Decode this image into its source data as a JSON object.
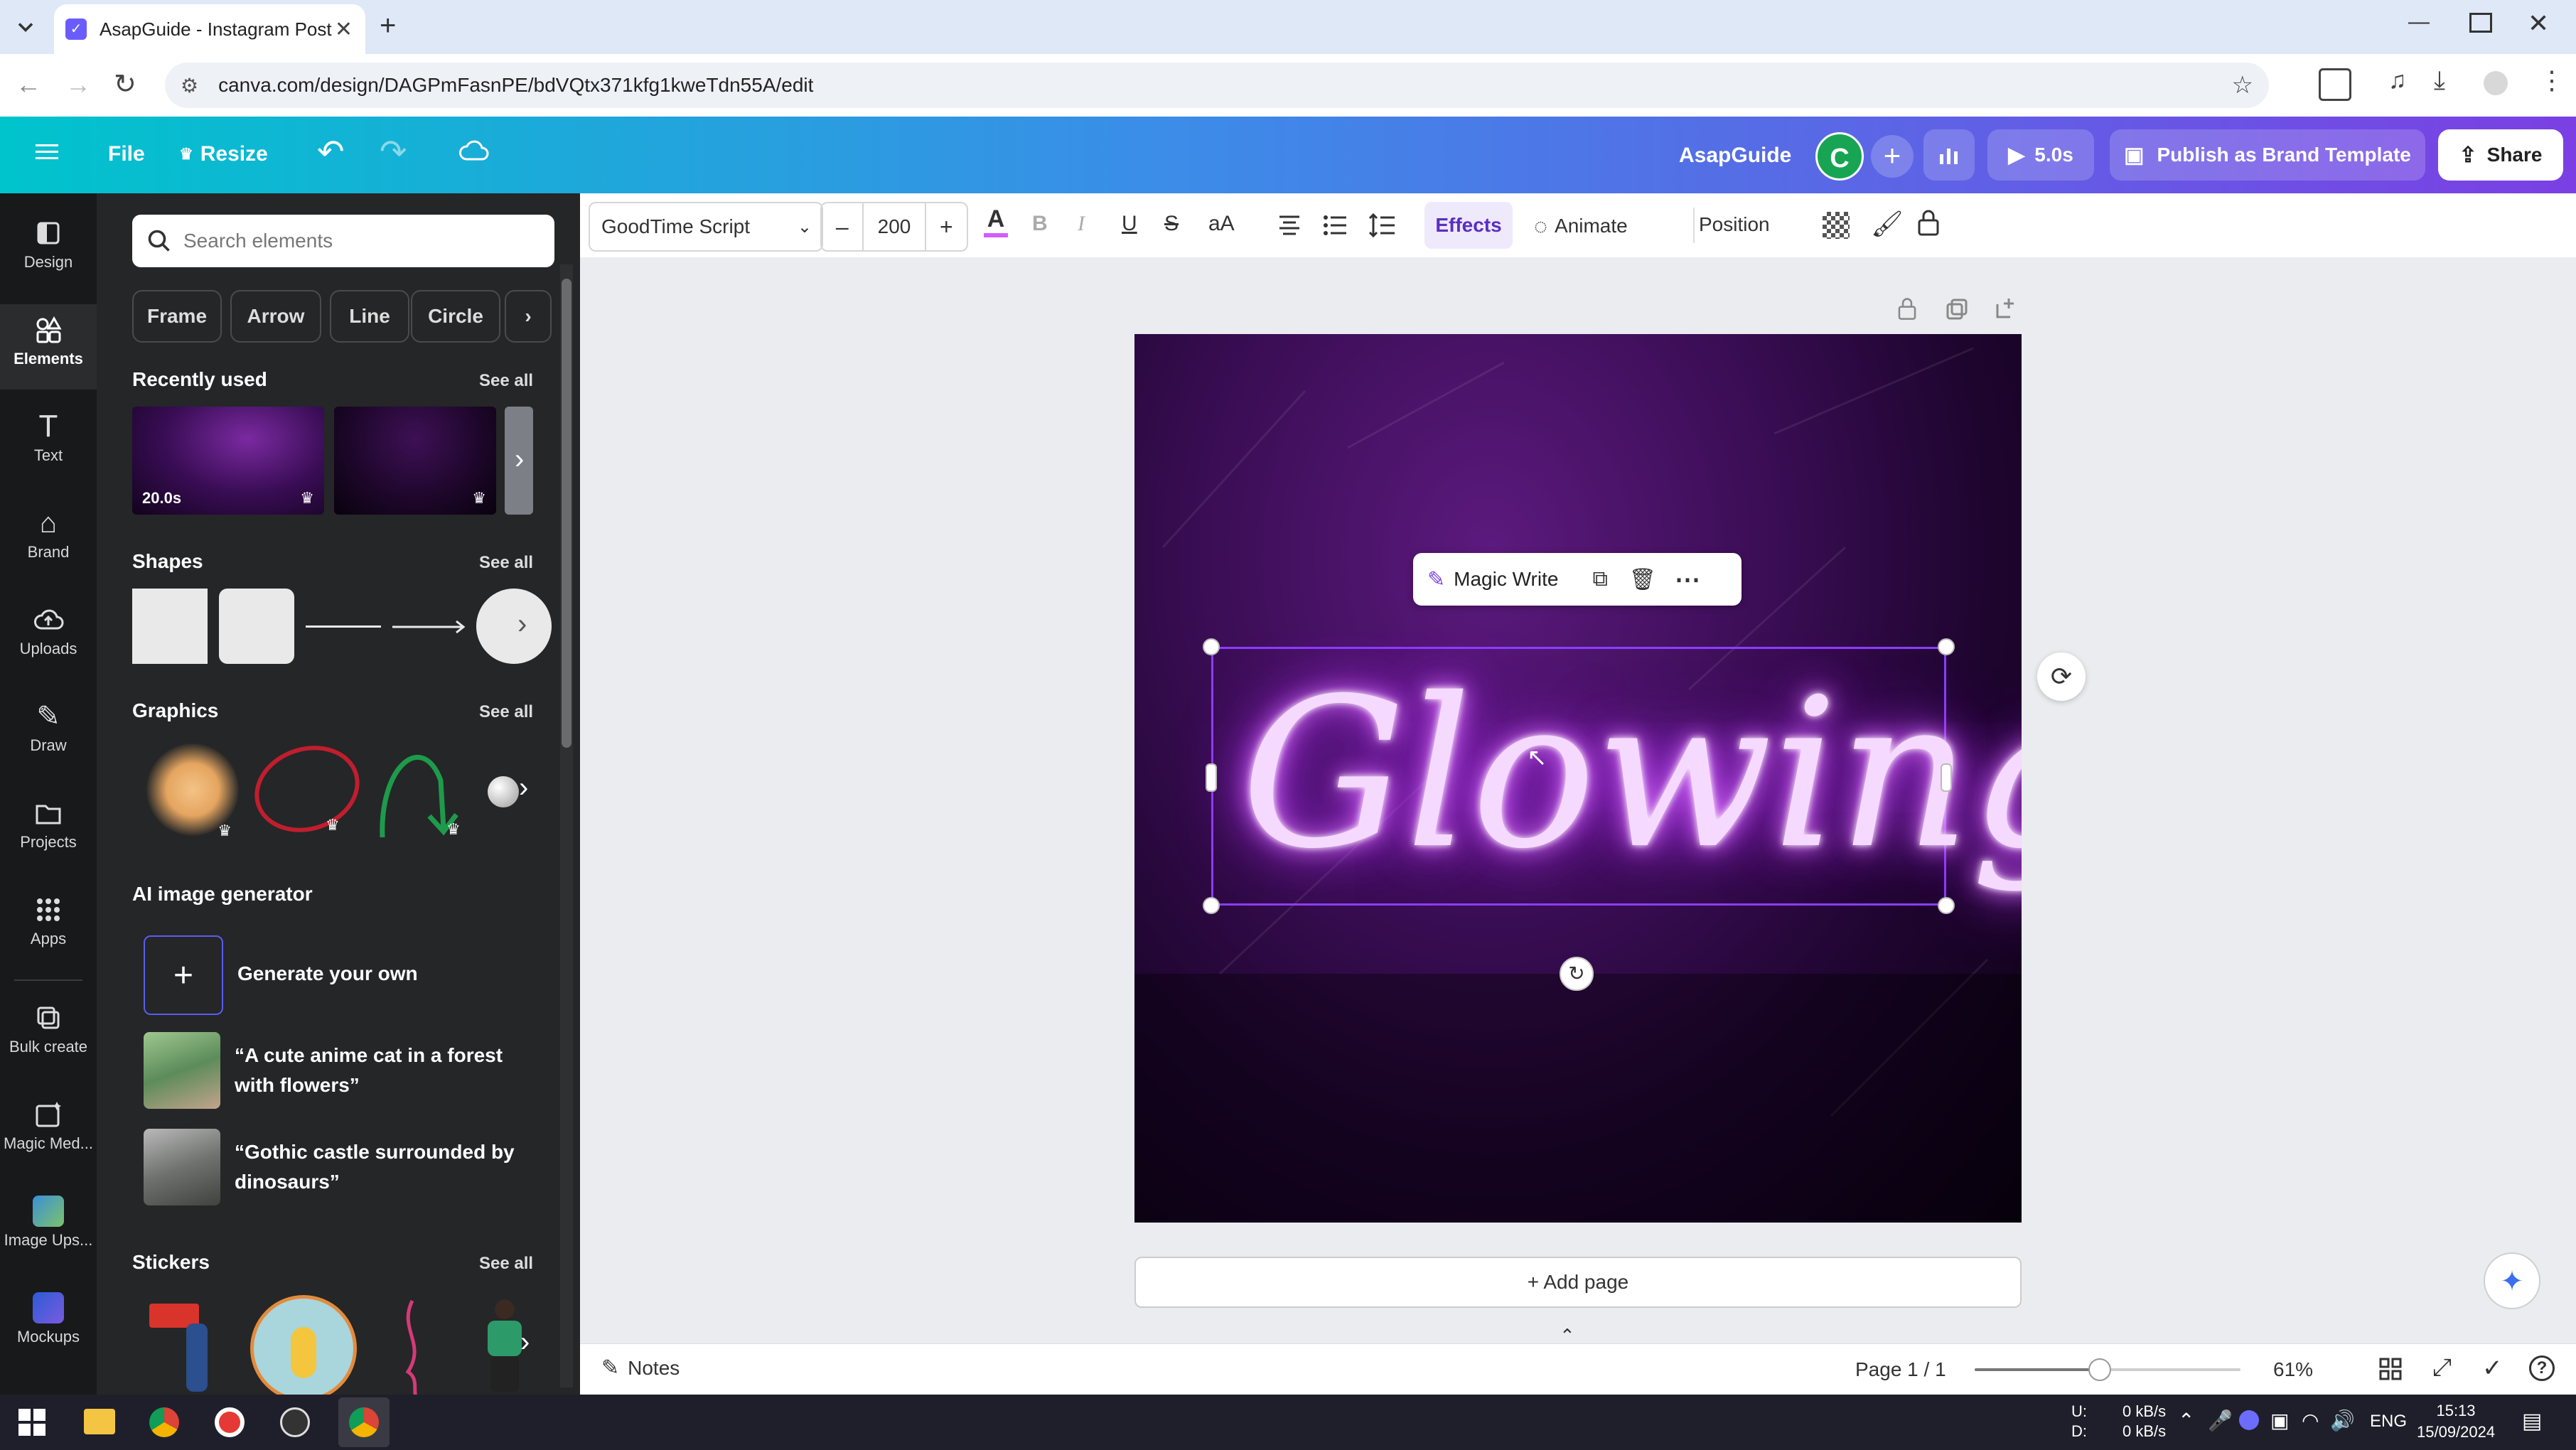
{
  "browser": {
    "tab_title": "AsapGuide - Instagram Post",
    "url": "canva.com/design/DAGPmFasnPE/bdVQtx371kfg1kweTdn55A/edit"
  },
  "header": {
    "file_label": "File",
    "resize_label": "Resize",
    "team_name": "AsapGuide",
    "avatar_letter": "C",
    "play_time": "5.0s",
    "publish_label": "Publish as Brand Template",
    "share_label": "Share"
  },
  "rail": {
    "items": [
      {
        "label": "Design"
      },
      {
        "label": "Elements"
      },
      {
        "label": "Text"
      },
      {
        "label": "Brand"
      },
      {
        "label": "Uploads"
      },
      {
        "label": "Draw"
      },
      {
        "label": "Projects"
      },
      {
        "label": "Apps"
      },
      {
        "label": "Bulk create"
      },
      {
        "label": "Magic Med..."
      },
      {
        "label": "Image Ups..."
      },
      {
        "label": "Mockups"
      }
    ]
  },
  "panel": {
    "search_placeholder": "Search elements",
    "chips": [
      "Frame",
      "Arrow",
      "Line",
      "Circle"
    ],
    "recently_used": {
      "title": "Recently used",
      "see_all": "See all",
      "duration": "20.0s"
    },
    "shapes": {
      "title": "Shapes",
      "see_all": "See all"
    },
    "graphics": {
      "title": "Graphics",
      "see_all": "See all"
    },
    "ai": {
      "title": "AI image generator",
      "generate": "Generate your own",
      "prompts": [
        "“A cute anime cat in a forest with flowers”",
        "“Gothic castle surrounded by dinosaurs”"
      ]
    },
    "stickers": {
      "title": "Stickers",
      "see_all": "See all"
    }
  },
  "toolbar": {
    "font": "GoodTime Script",
    "font_size": "200",
    "effects": "Effects",
    "animate": "Animate",
    "position": "Position"
  },
  "canvas": {
    "text": "Glowing",
    "magic_write": "Magic Write",
    "add_page": "+ Add page"
  },
  "bottom": {
    "notes": "Notes",
    "page": "Page 1 / 1",
    "zoom": "61%",
    "zoom_fraction": 0.47
  },
  "taskbar": {
    "net_up_label": "U:",
    "net_down_label": "D:",
    "net_up": "0 kB/s",
    "net_down": "0 kB/s",
    "lang": "ENG",
    "time": "15:13",
    "date": "15/09/2024"
  },
  "colors": {
    "accent": "#8b3dff",
    "neon": "#f6d9ff",
    "glow": "#d35cff"
  }
}
